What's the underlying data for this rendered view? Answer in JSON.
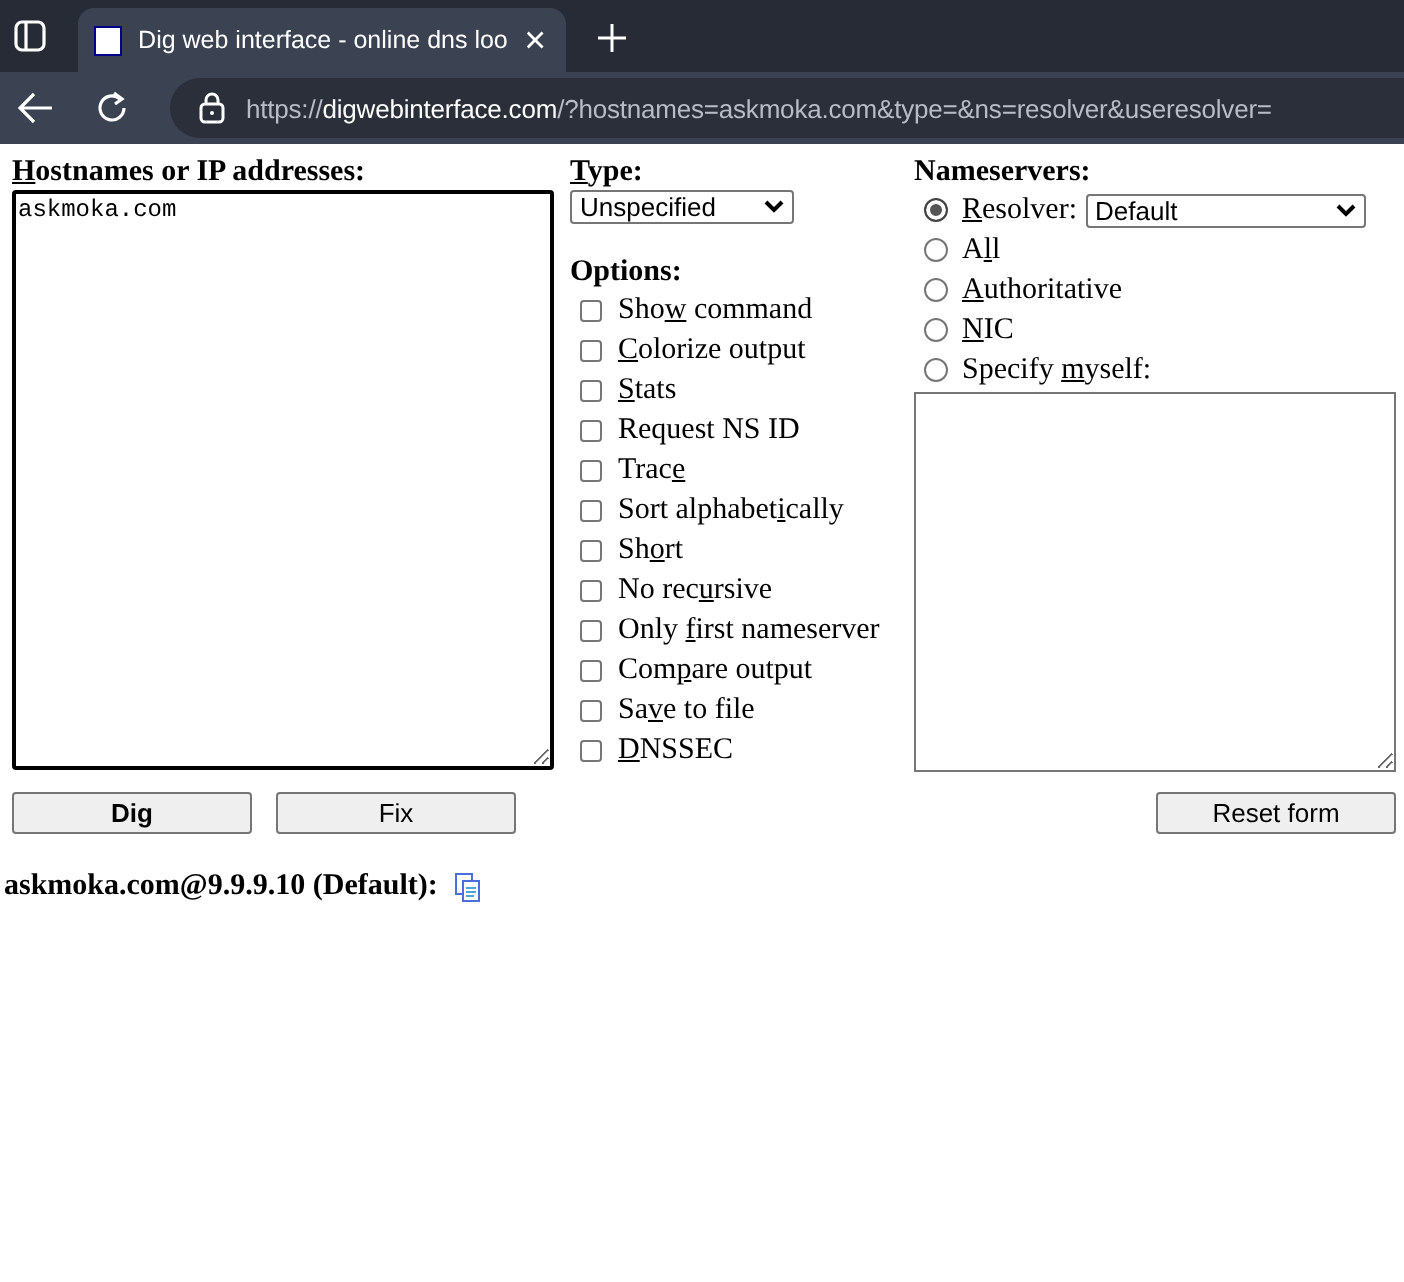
{
  "browser": {
    "tab_title": "Dig web interface - online dns loo",
    "url_host": "digwebinterface.com",
    "url_prefix": "https://",
    "url_rest": "/?hostnames=askmoka.com&type=&ns=resolver&useresolver="
  },
  "hostnames": {
    "label_parts": [
      {
        "text": "H",
        "underlined": true
      },
      {
        "text": "ostnames or IP addresses:",
        "underlined": false
      }
    ],
    "value": "askmoka.com"
  },
  "type": {
    "label_parts": [
      {
        "text": "T",
        "underlined": true
      },
      {
        "text": "ype:",
        "underlined": false
      }
    ],
    "value": "Unspecified"
  },
  "options": {
    "title": "Options:",
    "items": [
      {
        "label_parts": [
          {
            "text": "Sho",
            "underlined": false
          },
          {
            "text": "w",
            "underlined": true
          },
          {
            "text": " command",
            "underlined": false
          }
        ],
        "checked": false
      },
      {
        "label_parts": [
          {
            "text": "C",
            "underlined": true
          },
          {
            "text": "olorize output",
            "underlined": false
          }
        ],
        "checked": false
      },
      {
        "label_parts": [
          {
            "text": "S",
            "underlined": true
          },
          {
            "text": "tats",
            "underlined": false
          }
        ],
        "checked": false
      },
      {
        "label_parts": [
          {
            "text": "Request NS ID",
            "underlined": false
          }
        ],
        "checked": false
      },
      {
        "label_parts": [
          {
            "text": "Trac",
            "underlined": false
          },
          {
            "text": "e",
            "underlined": true
          }
        ],
        "checked": false
      },
      {
        "label_parts": [
          {
            "text": "Sort alphabet",
            "underlined": false
          },
          {
            "text": "i",
            "underlined": true
          },
          {
            "text": "cally",
            "underlined": false
          }
        ],
        "checked": false
      },
      {
        "label_parts": [
          {
            "text": "Sh",
            "underlined": false
          },
          {
            "text": "o",
            "underlined": true
          },
          {
            "text": "rt",
            "underlined": false
          }
        ],
        "checked": false
      },
      {
        "label_parts": [
          {
            "text": "No rec",
            "underlined": false
          },
          {
            "text": "u",
            "underlined": true
          },
          {
            "text": "rsive",
            "underlined": false
          }
        ],
        "checked": false
      },
      {
        "label_parts": [
          {
            "text": "Only ",
            "underlined": false
          },
          {
            "text": "f",
            "underlined": true
          },
          {
            "text": "irst nameserver",
            "underlined": false
          }
        ],
        "checked": false
      },
      {
        "label_parts": [
          {
            "text": "Com",
            "underlined": false
          },
          {
            "text": "p",
            "underlined": true
          },
          {
            "text": "are output",
            "underlined": false
          }
        ],
        "checked": false
      },
      {
        "label_parts": [
          {
            "text": "Sa",
            "underlined": false
          },
          {
            "text": "v",
            "underlined": true
          },
          {
            "text": "e to file",
            "underlined": false
          }
        ],
        "checked": false
      },
      {
        "label_parts": [
          {
            "text": "D",
            "underlined": true
          },
          {
            "text": "NSSEC",
            "underlined": false
          }
        ],
        "checked": false
      }
    ]
  },
  "nameservers": {
    "title": "Nameservers:",
    "items": [
      {
        "kind": "select",
        "label_parts": [
          {
            "text": "R",
            "underlined": true
          },
          {
            "text": "esolver:",
            "underlined": false
          }
        ],
        "selected": true,
        "value": "Default"
      },
      {
        "kind": "plain",
        "label_parts": [
          {
            "text": "A",
            "underlined": false
          },
          {
            "text": "l",
            "underlined": true
          },
          {
            "text": "l",
            "underlined": false
          }
        ],
        "selected": false
      },
      {
        "kind": "plain",
        "label_parts": [
          {
            "text": "A",
            "underlined": true
          },
          {
            "text": "uthoritative",
            "underlined": false
          }
        ],
        "selected": false
      },
      {
        "kind": "plain",
        "label_parts": [
          {
            "text": "N",
            "underlined": true
          },
          {
            "text": "IC",
            "underlined": false
          }
        ],
        "selected": false
      },
      {
        "kind": "plain",
        "label_parts": [
          {
            "text": "Specify ",
            "underlined": false
          },
          {
            "text": "m",
            "underlined": true
          },
          {
            "text": "yself:",
            "underlined": false
          }
        ],
        "selected": false
      }
    ]
  },
  "buttons": [
    {
      "label": "Dig",
      "default": true
    },
    {
      "label": "Fix",
      "default": false
    }
  ],
  "reset_button": "Reset form",
  "result_heading": "askmoka.com@9.9.9.10 (Default):"
}
